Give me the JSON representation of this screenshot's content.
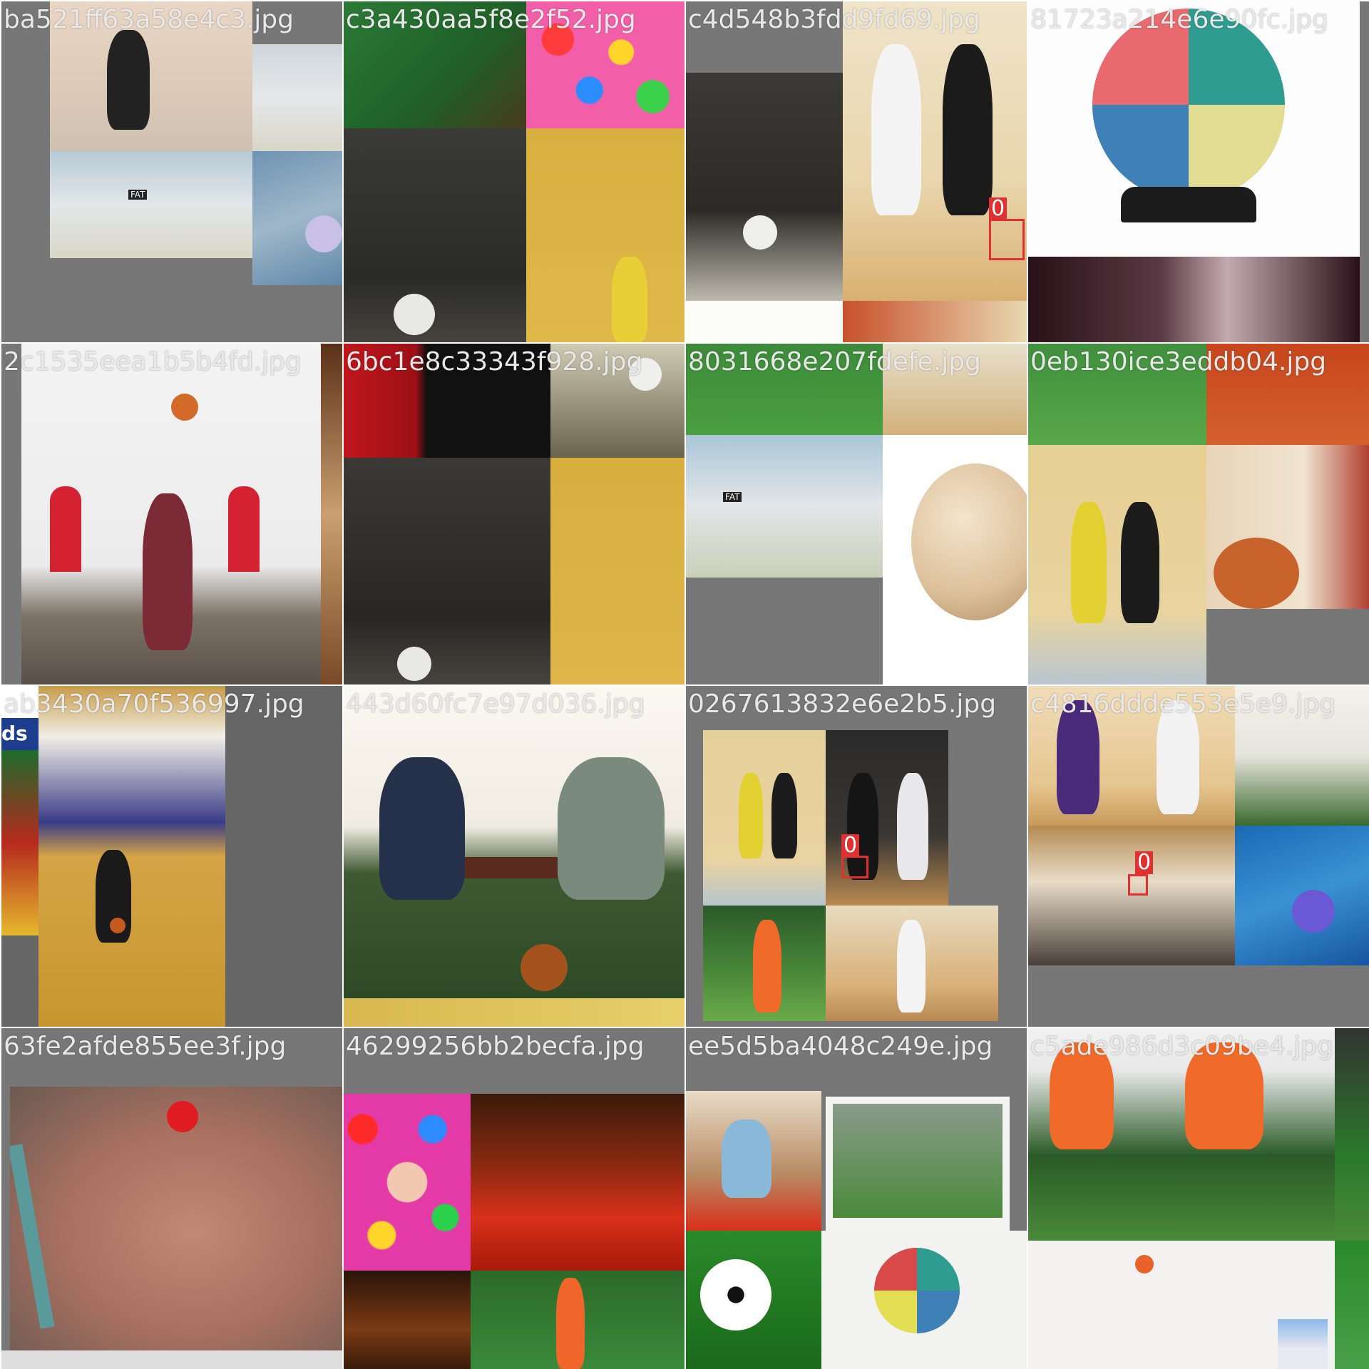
{
  "tiles": [
    {
      "filename": "ba521ff63a58e4c3.jpg",
      "detections": []
    },
    {
      "filename": "c3a430aa5f8e2f52.jpg",
      "detections": []
    },
    {
      "filename": "c4d548b3fdd9fd69.jpg",
      "detections": [
        {
          "label": "0"
        }
      ]
    },
    {
      "filename": "81723a214e6e90fc.jpg",
      "detections": []
    },
    {
      "filename": "2c1535eea1b5b4fd.jpg",
      "detections": []
    },
    {
      "filename": "6bc1e8c33343f928.jpg",
      "detections": []
    },
    {
      "filename": "8031668e207fdefe.jpg",
      "detections": []
    },
    {
      "filename": "0eb130ice3eddb04.jpg",
      "detections": []
    },
    {
      "filename": "ab3430a70f536997.jpg",
      "detections": []
    },
    {
      "filename": "443d60fc7e97d036.jpg",
      "detections": []
    },
    {
      "filename": "0267613832e6e2b5.jpg",
      "detections": [
        {
          "label": "0"
        }
      ]
    },
    {
      "filename": "c4816ddde553e5e9.jpg",
      "detections": [
        {
          "label": "0"
        }
      ]
    },
    {
      "filename": "63fe2afde855ee3f.jpg",
      "detections": []
    },
    {
      "filename": "46299256bb2becfa.jpg",
      "detections": []
    },
    {
      "filename": "ee5d5ba4048c249e.jpg",
      "detections": []
    },
    {
      "filename": "c5ade986d3c09be4.jpg",
      "detections": []
    }
  ],
  "colors": {
    "background": "#777777",
    "label_text": "#e8e8e8",
    "detection_box": "#e03030"
  },
  "sign_text": {
    "fatboy": "FAT",
    "ds": "ds"
  }
}
